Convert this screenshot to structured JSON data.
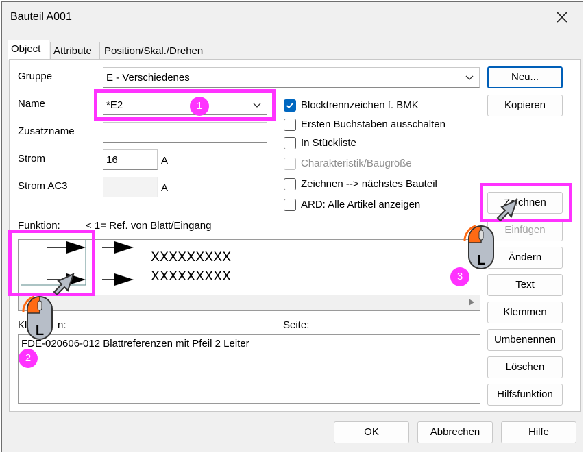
{
  "window": {
    "title": "Bauteil A001",
    "close_icon": "close-icon"
  },
  "tabs": [
    {
      "label": "Object"
    },
    {
      "label": "Attribute"
    },
    {
      "label": "Position/Skal./Drehen"
    }
  ],
  "form": {
    "gruppe_label": "Gruppe",
    "gruppe_value": "E - Verschiedenes",
    "name_label": "Name",
    "name_value": "*E2",
    "zusatzname_label": "Zusatzname",
    "zusatzname_value": "",
    "strom_label": "Strom",
    "strom_value": "16",
    "strom_unit": "A",
    "stromac3_label": "Strom AC3",
    "stromac3_value": "",
    "stromac3_unit": "A"
  },
  "checkboxes": [
    {
      "label": "Blocktrennzeichen f. BMK",
      "checked": true,
      "disabled": false
    },
    {
      "label": "Ersten Buchstaben ausschalten",
      "checked": false,
      "disabled": false
    },
    {
      "label": "In Stückliste",
      "checked": false,
      "disabled": false
    },
    {
      "label": "Charakteristik/Baugröße",
      "checked": false,
      "disabled": true
    },
    {
      "label": "Zeichnen --> nächstes Bauteil",
      "checked": false,
      "disabled": false
    },
    {
      "label": "ARD: Alle Artikel anzeigen",
      "checked": false,
      "disabled": false
    }
  ],
  "function": {
    "label": "Funktion:",
    "info": "< 1= Ref. von Blatt/Eingang",
    "line1": "XXXXXXXXX",
    "line2": "XXXXXXXXX"
  },
  "klemmen": {
    "label_visible": "Kl",
    "label_tail": "n:",
    "seite_label": "Seite:",
    "text": "FDE-020606-012  Blattreferenzen mit  Pfeil  2 Leiter"
  },
  "side_buttons": [
    "Neu...",
    "Kopieren",
    "Zeichnen",
    "Einfügen",
    "Ändern",
    "Text",
    "Klemmen",
    "Umbenennen",
    "Löschen",
    "Hilfsfunktion"
  ],
  "bottom_buttons": {
    "ok": "OK",
    "cancel": "Abbrechen",
    "help": "Hilfe"
  },
  "annotations": {
    "badge1": "1",
    "badge2": "2",
    "badge3": "3",
    "mouse_letter": "L",
    "highlight_color": "#ff33ff",
    "mouse_accent": "#ff6a13"
  }
}
